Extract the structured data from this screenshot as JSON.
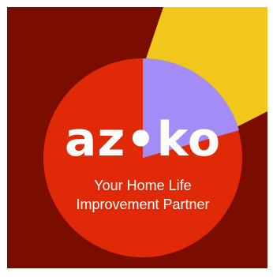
{
  "brand": {
    "name": "az•ko",
    "tagline_line1": "Your Home Life",
    "tagline_line2": "Improvement Partner"
  },
  "colors": {
    "background": "#7a0d00",
    "circle": "#e02a07",
    "wedge_purple": "#a48cf7",
    "wedge_yellow": "#f1c71c",
    "text": "#ffffff",
    "frame": "#ffffff"
  }
}
